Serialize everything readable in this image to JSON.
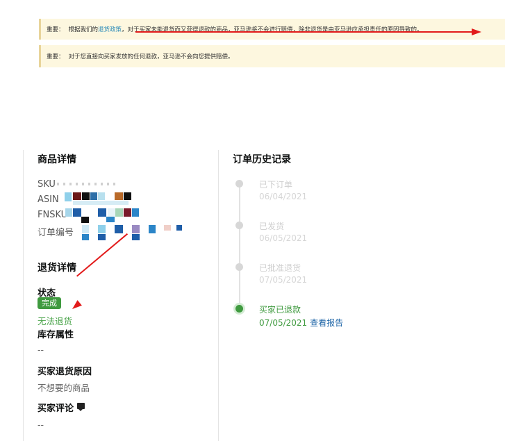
{
  "notices": [
    {
      "label": "重要：",
      "text_before": "根据我们的",
      "link": "退货政策",
      "text_after": "，对于买家未能退货而又获得退款的商品，亚马逊将不会进行赔偿，除非退货是由亚马逊应承担责任的原因导致的。"
    },
    {
      "label": "重要：",
      "text": "对于您直接向买家发放的任何退款，亚马逊不会向您提供赔偿。"
    }
  ],
  "product_details": {
    "title": "商品详情",
    "sku_label": "SKU",
    "asin_label": "ASIN",
    "fnsku_label": "FNSKU",
    "order_label": "订单编号"
  },
  "return_details": {
    "title": "退货详情",
    "status_label": "状态",
    "status_badge": "完成",
    "status_link": "无法退货",
    "inventory_label": "库存属性",
    "inventory_value": "--",
    "reason_label": "买家退货原因",
    "reason_value": "不想要的商品",
    "comment_label": "买家评论",
    "comment_value": "--"
  },
  "order_history": {
    "title": "订单历史记录",
    "events": [
      {
        "label": "已下订单",
        "date": "06/04/2021",
        "active": false
      },
      {
        "label": "已发货",
        "date": "06/05/2021",
        "active": false
      },
      {
        "label": "已批准退货",
        "date": "07/05/2021",
        "active": false
      },
      {
        "label": "买家已退款",
        "date": "07/05/2021",
        "active": true,
        "link": "查看报告"
      }
    ]
  },
  "colors": {
    "notice_bg": "#fdf7df",
    "success_green": "#3f9a3f",
    "link_blue": "#2167a8",
    "annotation_red": "#e21b1b"
  }
}
